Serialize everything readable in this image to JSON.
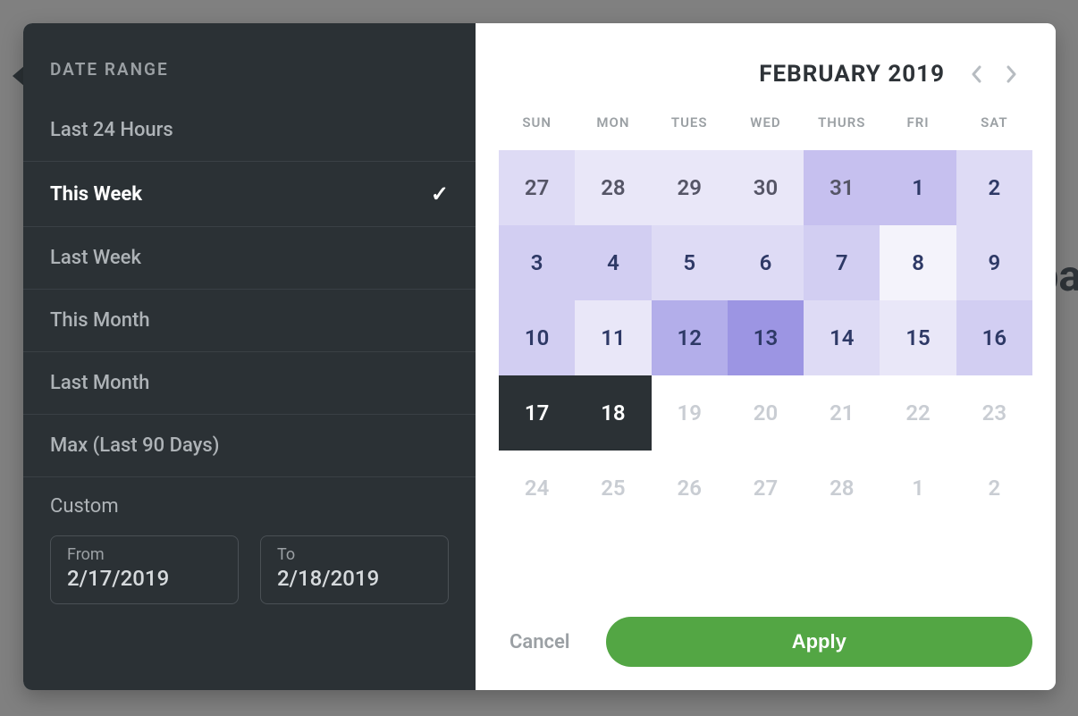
{
  "sidebar": {
    "title": "DATE RANGE",
    "items": [
      {
        "label": "Last 24 Hours",
        "selected": false
      },
      {
        "label": "This Week",
        "selected": true
      },
      {
        "label": "Last Week",
        "selected": false
      },
      {
        "label": "This Month",
        "selected": false
      },
      {
        "label": "Last Month",
        "selected": false
      },
      {
        "label": "Max (Last 90 Days)",
        "selected": false
      }
    ],
    "custom": {
      "title": "Custom",
      "from_label": "From",
      "from_value": "2/17/2019",
      "to_label": "To",
      "to_value": "2/18/2019"
    }
  },
  "calendar": {
    "title": "FEBRUARY 2019",
    "dow": [
      "SUN",
      "MON",
      "TUES",
      "WED",
      "THURS",
      "FRI",
      "SAT"
    ],
    "cells": [
      {
        "n": "27",
        "cls": "outside h2"
      },
      {
        "n": "28",
        "cls": "outside h1"
      },
      {
        "n": "29",
        "cls": "outside h1"
      },
      {
        "n": "30",
        "cls": "outside h1"
      },
      {
        "n": "31",
        "cls": "outside h4"
      },
      {
        "n": "1",
        "cls": "h4"
      },
      {
        "n": "2",
        "cls": "h2"
      },
      {
        "n": "3",
        "cls": "h3"
      },
      {
        "n": "4",
        "cls": "h3"
      },
      {
        "n": "5",
        "cls": "h2"
      },
      {
        "n": "6",
        "cls": "h2"
      },
      {
        "n": "7",
        "cls": "h3"
      },
      {
        "n": "8",
        "cls": "h0"
      },
      {
        "n": "9",
        "cls": "h2"
      },
      {
        "n": "10",
        "cls": "h3"
      },
      {
        "n": "11",
        "cls": "h1"
      },
      {
        "n": "12",
        "cls": "h5"
      },
      {
        "n": "13",
        "cls": "h6"
      },
      {
        "n": "14",
        "cls": "h2"
      },
      {
        "n": "15",
        "cls": "h1"
      },
      {
        "n": "16",
        "cls": "h3"
      },
      {
        "n": "17",
        "cls": "sel17"
      },
      {
        "n": "18",
        "cls": "sel18"
      },
      {
        "n": "19",
        "cls": "future"
      },
      {
        "n": "20",
        "cls": "future"
      },
      {
        "n": "21",
        "cls": "future"
      },
      {
        "n": "22",
        "cls": "future"
      },
      {
        "n": "23",
        "cls": "future"
      },
      {
        "n": "24",
        "cls": "future"
      },
      {
        "n": "25",
        "cls": "future"
      },
      {
        "n": "26",
        "cls": "future"
      },
      {
        "n": "27",
        "cls": "future"
      },
      {
        "n": "28",
        "cls": "future"
      },
      {
        "n": "1",
        "cls": "future"
      },
      {
        "n": "2",
        "cls": "future"
      }
    ]
  },
  "footer": {
    "cancel": "Cancel",
    "apply": "Apply"
  },
  "background_text": "ba"
}
